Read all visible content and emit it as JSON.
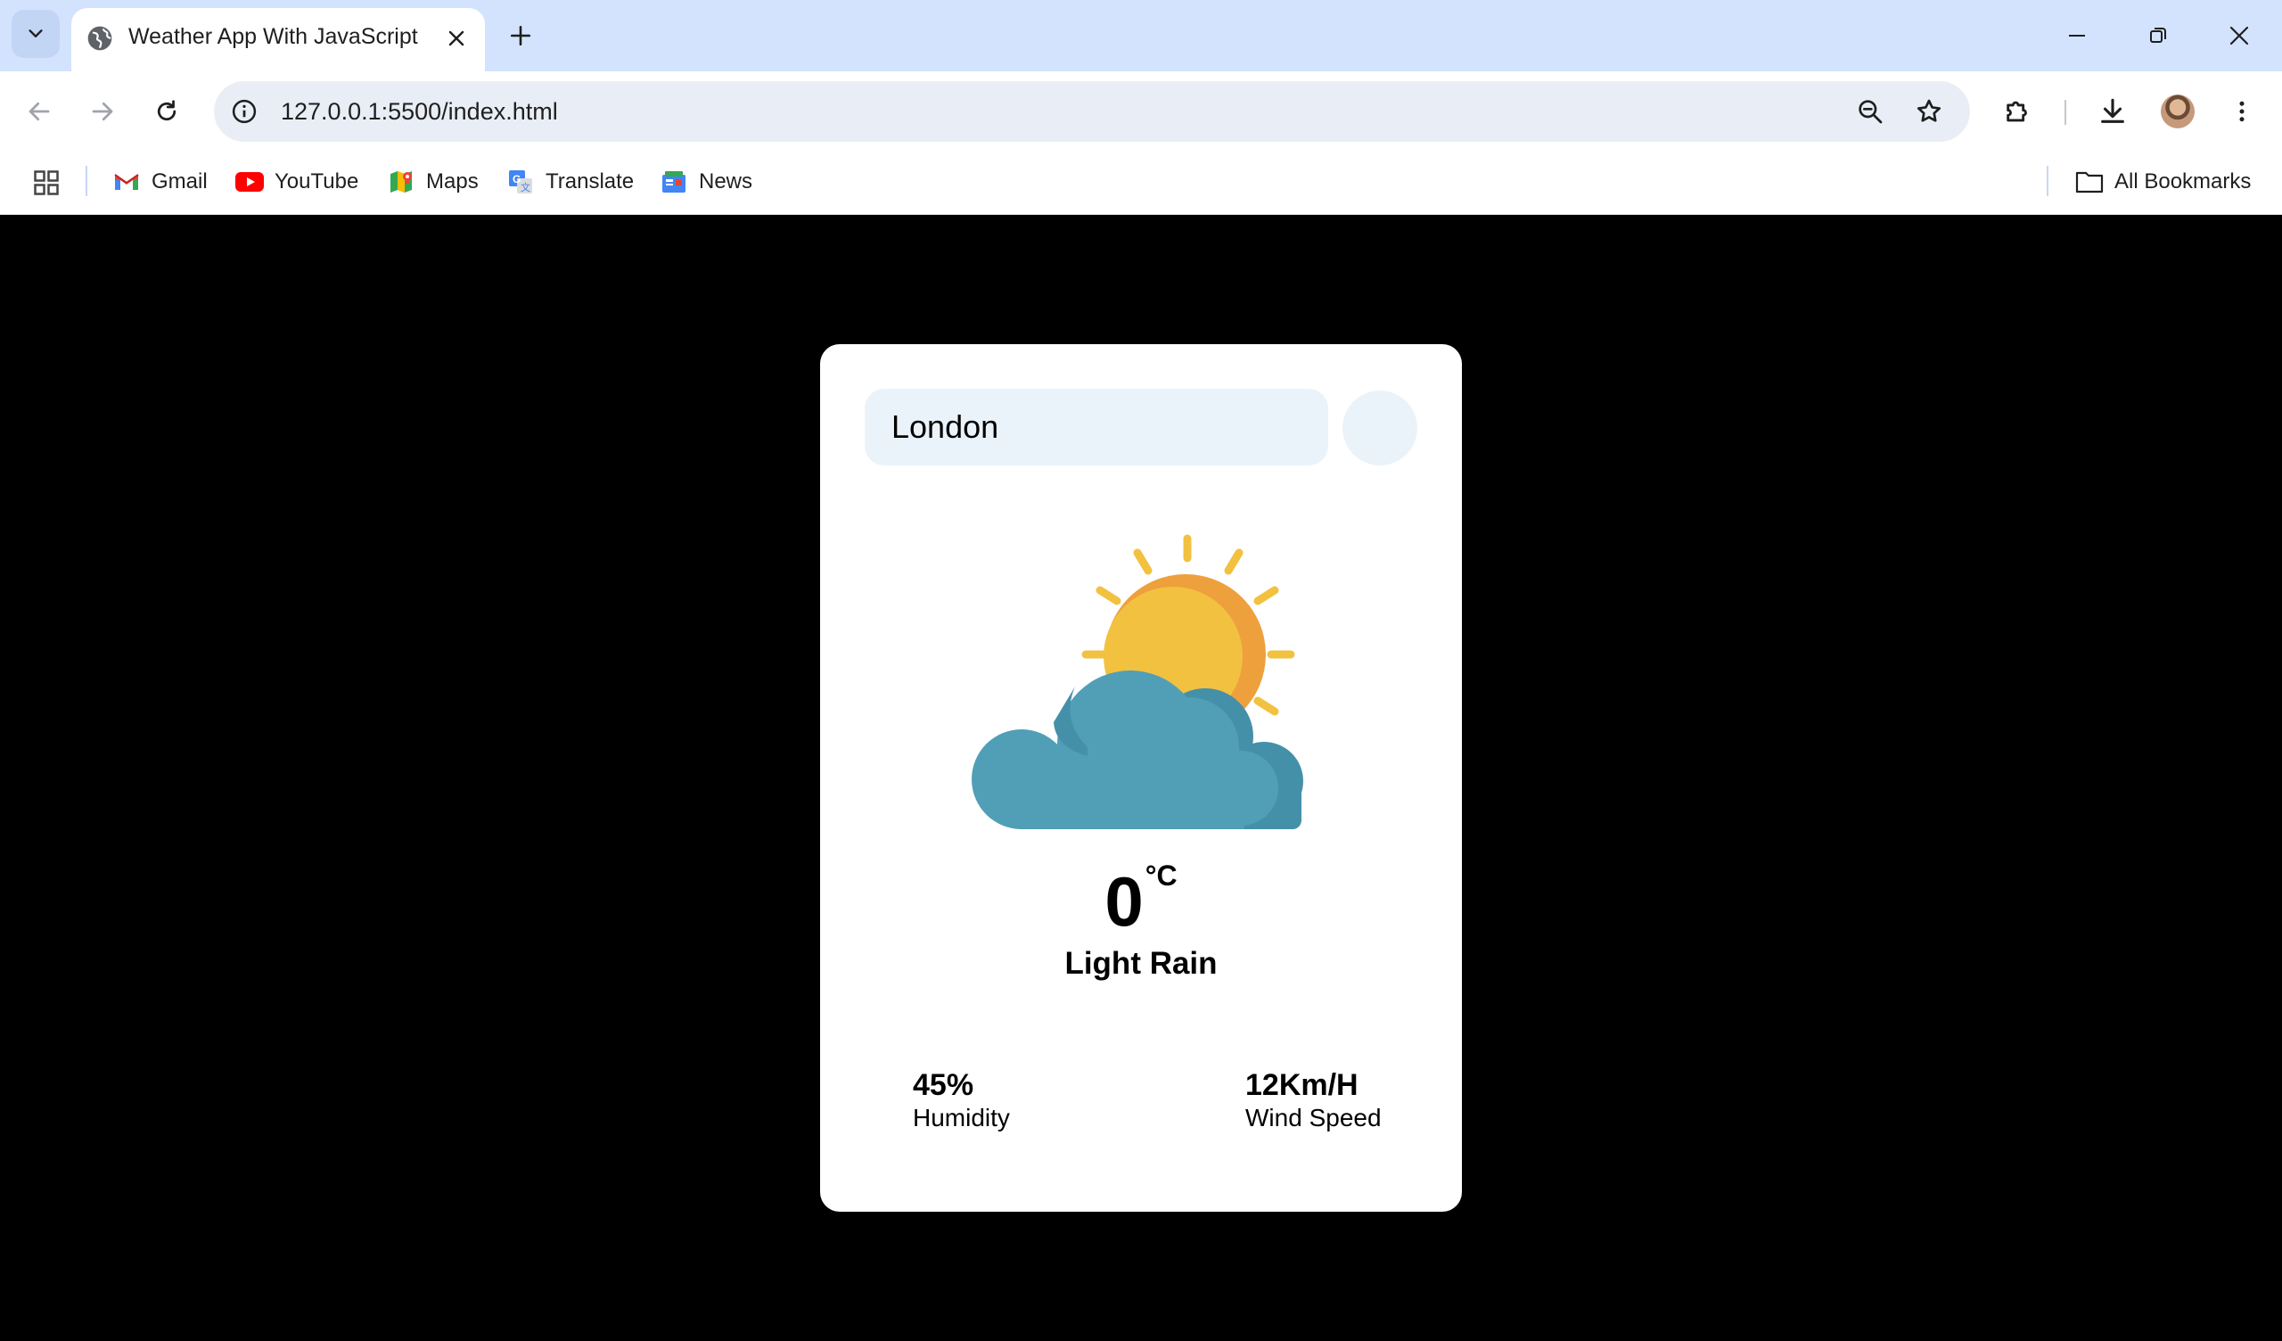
{
  "browser": {
    "tab_title": "Weather App With JavaScript",
    "url": "127.0.0.1:5500/index.html",
    "bookmarks": [
      {
        "label": "Gmail",
        "icon": "gmail-icon"
      },
      {
        "label": "YouTube",
        "icon": "youtube-icon"
      },
      {
        "label": "Maps",
        "icon": "maps-icon"
      },
      {
        "label": "Translate",
        "icon": "translate-icon"
      },
      {
        "label": "News",
        "icon": "news-icon"
      }
    ],
    "all_bookmarks_label": "All Bookmarks"
  },
  "weather": {
    "search_value": "London",
    "temperature": "0",
    "unit": "°C",
    "description": "Light Rain",
    "humidity_value": "45%",
    "humidity_label": "Humidity",
    "wind_value": "12Km/H",
    "wind_label": "Wind Speed",
    "condition_icon": "sun-behind-cloud-icon"
  },
  "colors": {
    "page_background": "#000000",
    "card_background": "#ffffff",
    "input_background": "#ebf3fa",
    "sun": "#f2c140",
    "cloud": "#519fb7"
  }
}
